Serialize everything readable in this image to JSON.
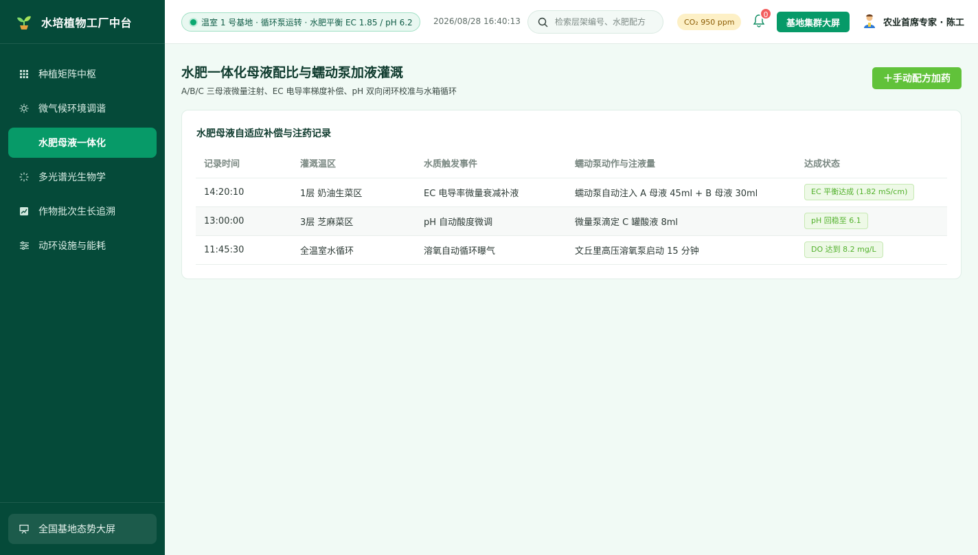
{
  "app": {
    "title": "水培植物工厂中台"
  },
  "sidebar": {
    "items": [
      {
        "label": "种植矩阵中枢",
        "icon": "grid-icon",
        "active": false
      },
      {
        "label": "微气候环境调谐",
        "icon": "sun-icon",
        "active": false
      },
      {
        "label": "水肥母液一体化",
        "icon": "drop-icon",
        "active": true
      },
      {
        "label": "多光谱光生物学",
        "icon": "sparkle-icon",
        "active": false
      },
      {
        "label": "作物批次生长追溯",
        "icon": "chart-icon",
        "active": false
      },
      {
        "label": "动环设施与能耗",
        "icon": "sliders-icon",
        "active": false
      }
    ],
    "footer_label": "全国基地态势大屏"
  },
  "header": {
    "status": "温室 1 号基地 · 循环泵运转 · 水肥平衡 EC 1.85 / pH 6.2",
    "datetime": "2026/08/28 16:40:13",
    "search_placeholder": "检索层架编号、水肥配方",
    "co2": "CO₂ 950 ppm",
    "notification_count": "0",
    "screen_button": "基地集群大屏",
    "user_name": "农业首席专家 · 陈工"
  },
  "page": {
    "title": "水肥一体化母液配比与蠕动泵加液灌溉",
    "subtitle": "A/B/C 三母液微量注射、EC 电导率梯度补偿、pH 双向闭环校准与水箱循环",
    "add_button": "＋手动配方加药"
  },
  "records": {
    "title": "水肥母液自适应补偿与注药记录",
    "columns": [
      "记录时间",
      "灌溉温区",
      "水质触发事件",
      "蠕动泵动作与注液量",
      "达成状态"
    ],
    "rows": [
      {
        "time": "14:20:10",
        "zone": "1层 奶油生菜区",
        "event": "EC 电导率微量衰减补液",
        "action": "蠕动泵自动注入 A 母液 45ml + B 母液 30ml",
        "status": "EC 平衡达成 (1.82 mS/cm)"
      },
      {
        "time": "13:00:00",
        "zone": "3层 芝麻菜区",
        "event": "pH 自动酸度微调",
        "action": "微量泵滴定 C 罐酸液 8ml",
        "status": "pH 回稳至 6.1"
      },
      {
        "time": "11:45:30",
        "zone": "全温室水循环",
        "event": "溶氧自动循环曝气",
        "action": "文丘里高压溶氧泵启动 15 分钟",
        "status": "DO 达到 8.2 mg/L"
      }
    ]
  },
  "colors": {
    "sidebar_bg": "#054a39",
    "accent": "#079a68",
    "action_green": "#61c23a",
    "page_bg": "#f1faf5",
    "badge_red": "#f25c5c"
  }
}
